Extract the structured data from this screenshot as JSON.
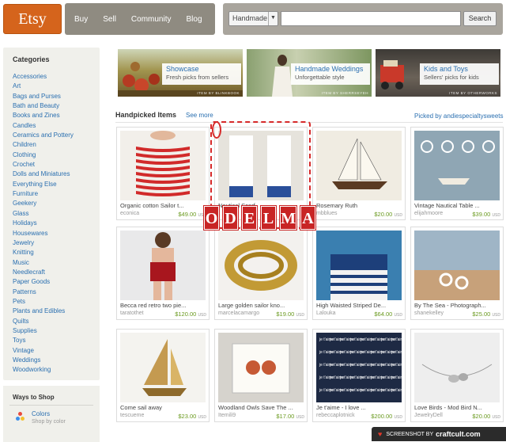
{
  "header": {
    "logo": "Etsy",
    "nav": [
      "Buy",
      "Sell",
      "Community",
      "Blog"
    ],
    "search_scope": "Handmade",
    "search_button": "Search"
  },
  "sidebar": {
    "title": "Categories",
    "categories": [
      "Accessories",
      "Art",
      "Bags and Purses",
      "Bath and Beauty",
      "Books and Zines",
      "Candles",
      "Ceramics and Pottery",
      "Children",
      "Clothing",
      "Crochet",
      "Dolls and Miniatures",
      "Everything Else",
      "Furniture",
      "Geekery",
      "Glass",
      "Holidays",
      "Housewares",
      "Jewelry",
      "Knitting",
      "Music",
      "Needlecraft",
      "Paper Goods",
      "Patterns",
      "Pets",
      "Plants and Edibles",
      "Quilts",
      "Supplies",
      "Toys",
      "Vintage",
      "Weddings",
      "Woodworking"
    ],
    "ways_title": "Ways to Shop",
    "colors_label": "Colors",
    "colors_sub": "Shop by color"
  },
  "banners": [
    {
      "title": "Showcase",
      "subtitle": "Fresh picks from sellers",
      "credit": "ITEM BY BLINKBOOK",
      "color": "#8a7a3a"
    },
    {
      "title": "Handmade Weddings",
      "subtitle": "Unforgettable style",
      "credit": "ITEM BY SHERRSEYEH",
      "color": "#6f8a4e"
    },
    {
      "title": "Kids and Toys",
      "subtitle": "Sellers' picks for kids",
      "credit": "ITEM BY OTHERWORKS",
      "color": "#b5452c"
    }
  ],
  "handpicked": {
    "title": "Handpicked Items",
    "see_more": "See more",
    "picked_by": "Picked by andiespecialtysweets"
  },
  "items": [
    {
      "title": "Organic cotton Sailor t...",
      "shop": "econica",
      "price": "$49.00",
      "currency": "USD"
    },
    {
      "title": "Nautical Scarf",
      "shop": "",
      "price": "",
      "currency": ""
    },
    {
      "title": "Rosemary Ruth",
      "shop": "mbblues",
      "price": "$20.00",
      "currency": "USD"
    },
    {
      "title": "Vintage Nautical Table ...",
      "shop": "elijahmoore",
      "price": "$39.00",
      "currency": "USD"
    },
    {
      "title": "Becca red retro two pie...",
      "shop": "taratothet",
      "price": "$120.00",
      "currency": "USD"
    },
    {
      "title": "Large golden sailor kno...",
      "shop": "marcelacamargo",
      "price": "$19.00",
      "currency": "USD"
    },
    {
      "title": "High Waisted Striped De...",
      "shop": "Lalouka",
      "price": "$64.00",
      "currency": "USD"
    },
    {
      "title": "By The Sea - Photograph...",
      "shop": "shanekelley",
      "price": "$25.00",
      "currency": "USD"
    },
    {
      "title": "Come sail away",
      "shop": "tescueme",
      "price": "$23.00",
      "currency": "USD"
    },
    {
      "title": "Woodland Owls Save The ...",
      "shop": "Itemili9",
      "price": "$17.00",
      "currency": "USD"
    },
    {
      "title": "Je t'aime - I love ...",
      "shop": "rebeccaplotnick",
      "price": "$200.00",
      "currency": "USD"
    },
    {
      "title": "Love Birds - Mod Bird N...",
      "shop": "JewelryDell",
      "price": "$20.00",
      "currency": "USD"
    }
  ],
  "overlay": {
    "letters": [
      "O",
      "D",
      "E",
      "L",
      "M",
      "A"
    ]
  },
  "footer": {
    "badge_prefix": "SCREENSHOT BY",
    "badge_brand": "craftcult.com"
  }
}
